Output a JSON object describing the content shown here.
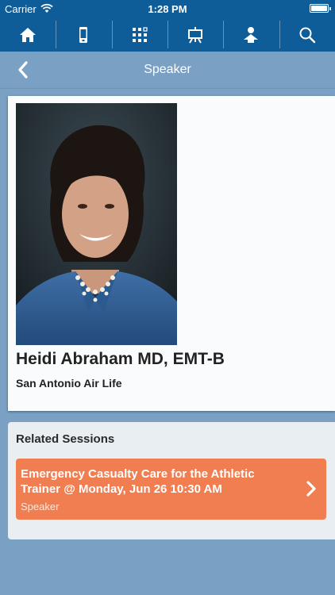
{
  "status_bar": {
    "carrier": "Carrier",
    "time": "1:28 PM"
  },
  "nav": {
    "icons": [
      "home-icon",
      "mobile-device-icon",
      "grid-icon",
      "presentation-board-icon",
      "speaker-person-icon",
      "search-icon"
    ],
    "background": "#0f5d98"
  },
  "header": {
    "title": "Speaker"
  },
  "speaker": {
    "name": "Heidi Abraham MD, EMT-B",
    "organization": "San Antonio Air Life"
  },
  "related_sessions": {
    "heading": "Related Sessions",
    "items": [
      {
        "title": "Emergency Casualty Care for the Athletic Trainer @ Monday, Jun 26 10:30 AM",
        "role": "Speaker",
        "color": "#f07e51"
      }
    ]
  },
  "colors": {
    "page_background": "#7aa1c4",
    "accent": "#f07e51"
  }
}
